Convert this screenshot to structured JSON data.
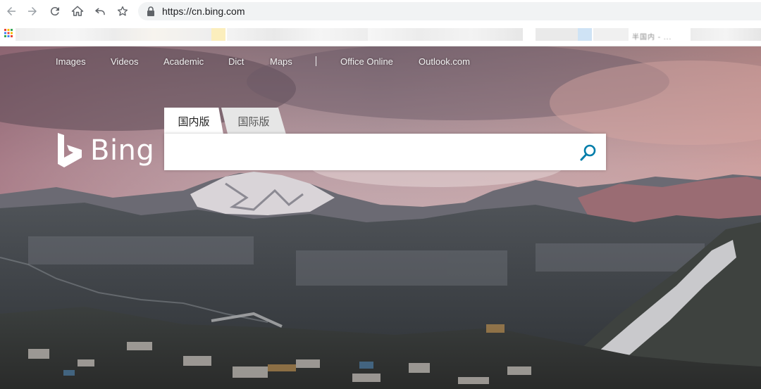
{
  "browser": {
    "url": "https://cn.bing.com",
    "buttons": [
      "back",
      "forward",
      "reload",
      "home",
      "undo",
      "bookmark"
    ],
    "bookmarks_partial_text": "半国内 - ..."
  },
  "nav": {
    "items": [
      {
        "label": "Images"
      },
      {
        "label": "Videos"
      },
      {
        "label": "Academic"
      },
      {
        "label": "Dict"
      },
      {
        "label": "Maps"
      },
      {
        "label": "Office Online"
      },
      {
        "label": "Outlook.com"
      }
    ]
  },
  "logo": {
    "text": "Bing"
  },
  "search": {
    "tabs": [
      {
        "label": "国内版",
        "active": true
      },
      {
        "label": "国际版",
        "active": false
      }
    ],
    "value": "",
    "placeholder": ""
  },
  "colors": {
    "accent": "#007daa",
    "nav_text": "#f1f1f1",
    "tab_inactive": "#e6e6e6"
  }
}
